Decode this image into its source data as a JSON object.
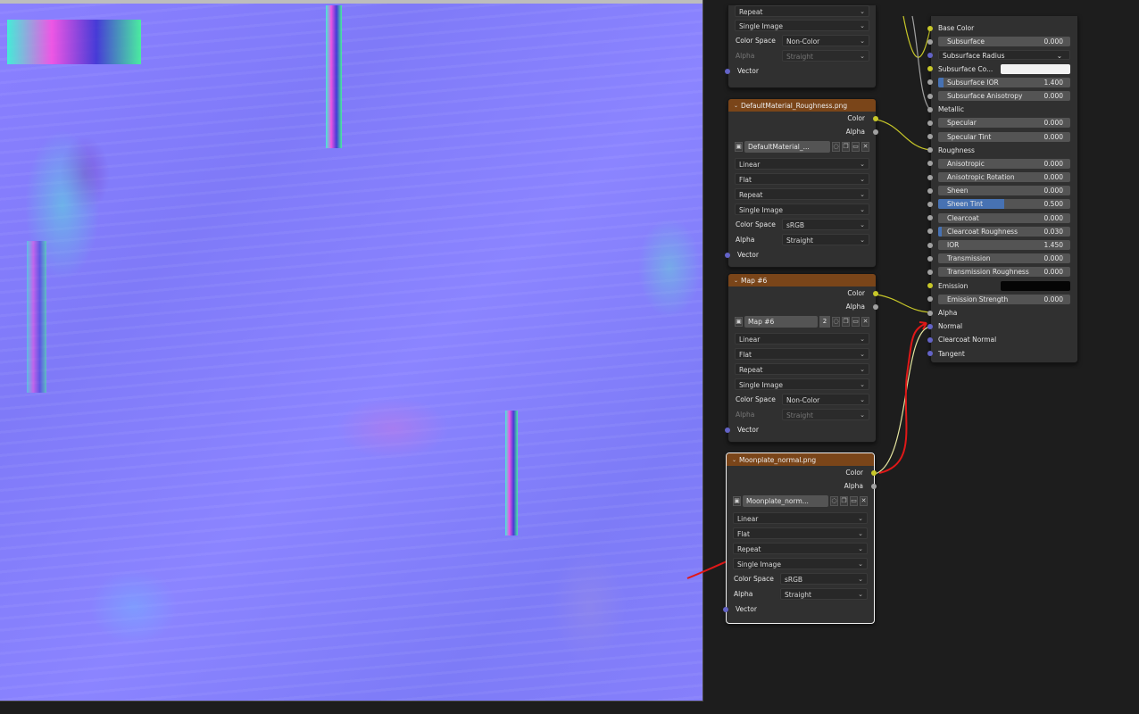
{
  "node_defaultmaterial_top": {
    "rows": [
      "Repeat",
      "Single Image"
    ],
    "color_space_label": "Color Space",
    "color_space_value": "Non-Color",
    "alpha_label": "Alpha",
    "alpha_value": "Straight",
    "vector_label": "Vector"
  },
  "node_roughness": {
    "title": "DefaultMaterial_Roughness.png",
    "out_color": "Color",
    "out_alpha": "Alpha",
    "image_name": "DefaultMaterial_...",
    "interpolation": "Linear",
    "projection": "Flat",
    "extension": "Repeat",
    "source": "Single Image",
    "color_space_label": "Color Space",
    "color_space_value": "sRGB",
    "alpha_label": "Alpha",
    "alpha_value": "Straight",
    "vector_label": "Vector"
  },
  "node_map6": {
    "title": "Map #6",
    "out_color": "Color",
    "out_alpha": "Alpha",
    "image_name": "Map #6",
    "user_count": "2",
    "interpolation": "Linear",
    "projection": "Flat",
    "extension": "Repeat",
    "source": "Single Image",
    "color_space_label": "Color Space",
    "color_space_value": "Non-Color",
    "alpha_label": "Alpha",
    "alpha_value": "Straight",
    "vector_label": "Vector"
  },
  "node_moonplate": {
    "title": "Moonplate_normal.png",
    "out_color": "Color",
    "out_alpha": "Alpha",
    "image_name": "Moonplate_norm...",
    "interpolation": "Linear",
    "projection": "Flat",
    "extension": "Repeat",
    "source": "Single Image",
    "color_space_label": "Color Space",
    "color_space_value": "sRGB",
    "alpha_label": "Alpha",
    "alpha_value": "Straight",
    "vector_label": "Vector"
  },
  "bsdf": {
    "base_color": "Base Color",
    "subsurface": {
      "label": "Subsurface",
      "value": "0.000"
    },
    "subsurface_radius": "Subsurface Radius",
    "subsurface_color": "Subsurface Co...",
    "subsurface_ior": {
      "label": "Subsurface IOR",
      "value": "1.400"
    },
    "subsurface_anisotropy": {
      "label": "Subsurface Anisotropy",
      "value": "0.000"
    },
    "metallic": "Metallic",
    "specular": {
      "label": "Specular",
      "value": "0.000"
    },
    "specular_tint": {
      "label": "Specular Tint",
      "value": "0.000"
    },
    "roughness": "Roughness",
    "anisotropic": {
      "label": "Anisotropic",
      "value": "0.000"
    },
    "anisotropic_rotation": {
      "label": "Anisotropic Rotation",
      "value": "0.000"
    },
    "sheen": {
      "label": "Sheen",
      "value": "0.000"
    },
    "sheen_tint": {
      "label": "Sheen Tint",
      "value": "0.500"
    },
    "clearcoat": {
      "label": "Clearcoat",
      "value": "0.000"
    },
    "clearcoat_roughness": {
      "label": "Clearcoat Roughness",
      "value": "0.030"
    },
    "ior": {
      "label": "IOR",
      "value": "1.450"
    },
    "transmission": {
      "label": "Transmission",
      "value": "0.000"
    },
    "transmission_roughness": {
      "label": "Transmission Roughness",
      "value": "0.000"
    },
    "emission": "Emission",
    "emission_strength": {
      "label": "Emission Strength",
      "value": "0.000"
    },
    "alpha": "Alpha",
    "normal": "Normal",
    "clearcoat_normal": "Clearcoat Normal",
    "tangent": "Tangent"
  },
  "colors": {
    "node_header_image": "#7a4519",
    "node_body": "#303030",
    "field_fill": "#4772b3",
    "socket_color": "#c7c729",
    "socket_float": "#a1a1a1",
    "socket_vector": "#6363c7",
    "annotation_arrow": "#e01818"
  },
  "icons": [
    "chevron-down-icon",
    "image-icon",
    "shield-icon",
    "duplicate-icon",
    "folder-icon",
    "close-icon"
  ]
}
